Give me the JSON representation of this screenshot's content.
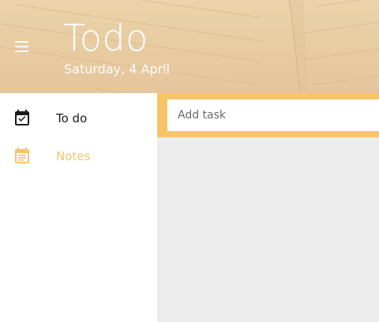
{
  "header": {
    "title": "Todo",
    "date": "Saturday, 4 April",
    "menu_icon": "hamburger-menu-icon"
  },
  "sidebar": {
    "items": [
      {
        "label": "To do",
        "icon": "calendar-check-icon",
        "active": true,
        "color": "#1a1a1a"
      },
      {
        "label": "Notes",
        "icon": "calendar-notes-icon",
        "active": false,
        "color": "#f6c46c"
      }
    ]
  },
  "task": {
    "placeholder": "Add task",
    "value": ""
  },
  "colors": {
    "accent": "#f8c46a",
    "header_bg": "#e9cda4",
    "content_bg": "#ececec",
    "sidebar_bg": "#ffffff"
  }
}
